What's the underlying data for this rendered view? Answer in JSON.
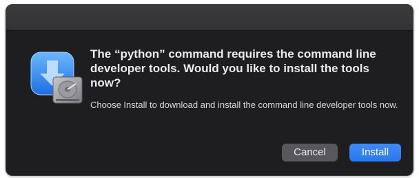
{
  "dialog": {
    "headline": "The “python” command requires the command line developer tools. Would you like to install the tools now?",
    "message": "Choose Install to download and install the command line developer tools now.",
    "icon": "installer-icon",
    "buttons": {
      "cancel_label": "Cancel",
      "install_label": "Install"
    }
  },
  "colors": {
    "dialog_background": "#1e1e20",
    "titlebar": "#3a3a3c",
    "primary_button": "#2a78ee",
    "secondary_button": "#58585c"
  }
}
